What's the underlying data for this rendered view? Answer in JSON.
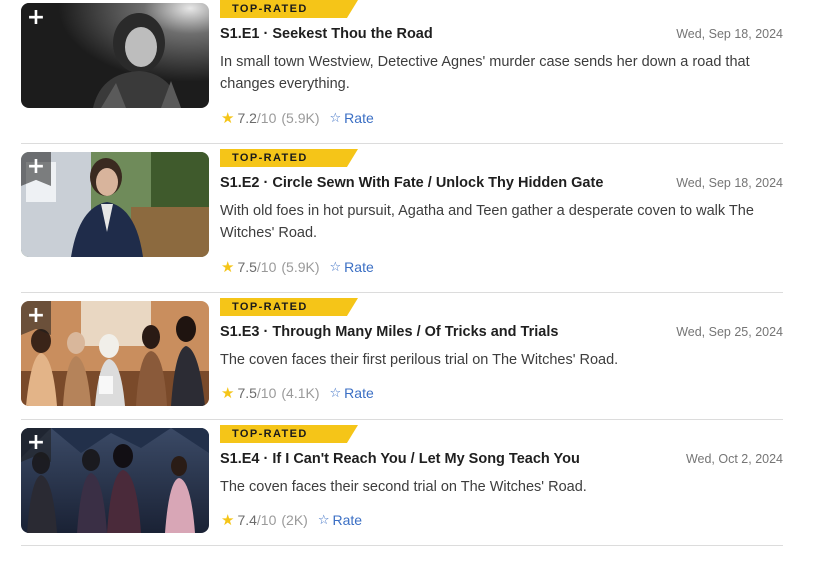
{
  "episodes": [
    {
      "badge": "TOP-RATED",
      "title": "S1.E1 · Seekest Thou the Road",
      "date": "Wed, Sep 18, 2024",
      "description": "In small town Westview, Detective Agnes' murder case sends her down a road that changes everything.",
      "rating": "7.2",
      "out_of": "/10",
      "votes": "(5.9K)",
      "rate_label": "Rate"
    },
    {
      "badge": "TOP-RATED",
      "title": "S1.E2 · Circle Sewn With Fate / Unlock Thy Hidden Gate",
      "date": "Wed, Sep 18, 2024",
      "description": "With old foes in hot pursuit, Agatha and Teen gather a desperate coven to walk The Witches' Road.",
      "rating": "7.5",
      "out_of": "/10",
      "votes": "(5.9K)",
      "rate_label": "Rate"
    },
    {
      "badge": "TOP-RATED",
      "title": "S1.E3 · Through Many Miles / Of Tricks and Trials",
      "date": "Wed, Sep 25, 2024",
      "description": "The coven faces their first perilous trial on The Witches' Road.",
      "rating": "7.5",
      "out_of": "/10",
      "votes": "(4.1K)",
      "rate_label": "Rate"
    },
    {
      "badge": "TOP-RATED",
      "title": "S1.E4 · If I Can't Reach You / Let My Song Teach You",
      "date": "Wed, Oct 2, 2024",
      "description": "The coven faces their second trial on The Witches' Road.",
      "rating": "7.4",
      "out_of": "/10",
      "votes": "(2K)",
      "rate_label": "Rate"
    }
  ],
  "icons": {
    "add": "+",
    "star_filled": "★",
    "star_outline": "☆"
  },
  "colors": {
    "badge": "#f5c518",
    "link": "#3b6fc4",
    "star": "#f5c518"
  }
}
